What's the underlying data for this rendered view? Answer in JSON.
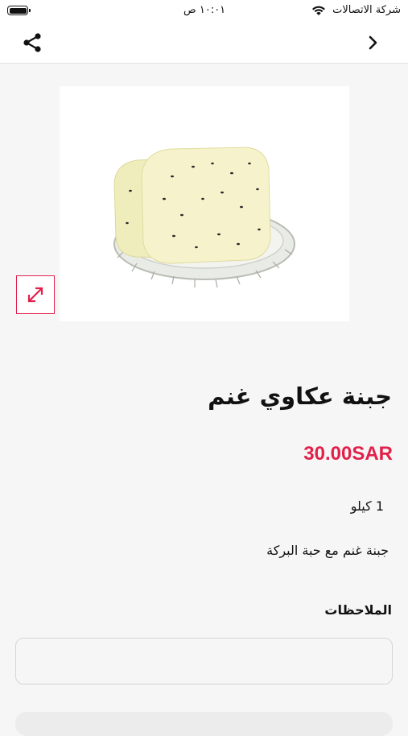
{
  "status_bar": {
    "carrier": "شركة الاتصالات",
    "time": "١٠:٠١ ص",
    "wifi_icon": "wifi-icon",
    "battery_icon": "battery-icon"
  },
  "nav": {
    "share_icon": "share-icon",
    "back_icon": "chevron-right-icon"
  },
  "product": {
    "image_alt": "cheese-on-glass-plate",
    "expand_icon": "expand-icon",
    "title": "جبنة عكاوي غنم",
    "price": "30.00SAR",
    "weight": "1 كيلو",
    "description": "جبنة غنم مع حبة البركة"
  },
  "notes": {
    "label": "الملاحظات",
    "value": "",
    "placeholder": ""
  },
  "colors": {
    "accent": "#e2204a",
    "background": "#f6f6f6"
  }
}
